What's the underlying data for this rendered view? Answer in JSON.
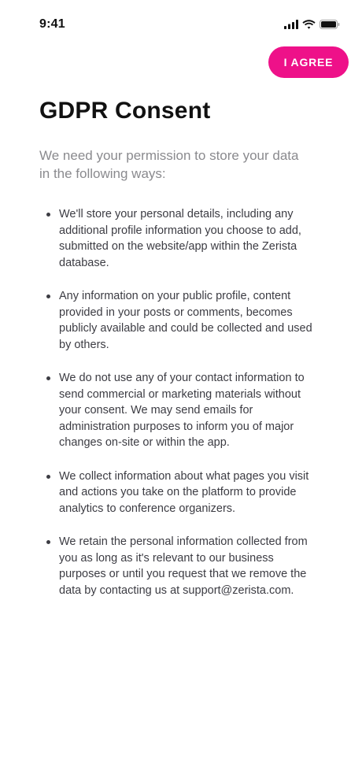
{
  "status_bar": {
    "time": "9:41",
    "icons": [
      "cellular-signal-icon",
      "wifi-icon",
      "battery-icon"
    ]
  },
  "actions": {
    "agree_label": "I AGREE",
    "accent_color": "#ee1189"
  },
  "page": {
    "title": "GDPR Consent",
    "intro": "We need your permission to store your data in the following ways:"
  },
  "consent_items": [
    {
      "text": "We'll store your personal details, including any additional profile information you choose to add, submitted on the website/app within the Zerista database."
    },
    {
      "text": "Any information on your public profile, content provided in your posts or comments, becomes publicly available and could be collected and used by others."
    },
    {
      "text": "We do not use any of your contact information to send commercial or marketing materials without your consent. We may send emails for administration purposes to inform you of major changes on-site or within the app."
    },
    {
      "text": "We collect information about what pages you visit and actions you take on the platform to provide analytics to conference organizers."
    },
    {
      "text": "We retain the personal information collected from you as long as it's relevant to our business purposes or until you request that we remove the data by contacting us at support@zerista.com."
    }
  ]
}
